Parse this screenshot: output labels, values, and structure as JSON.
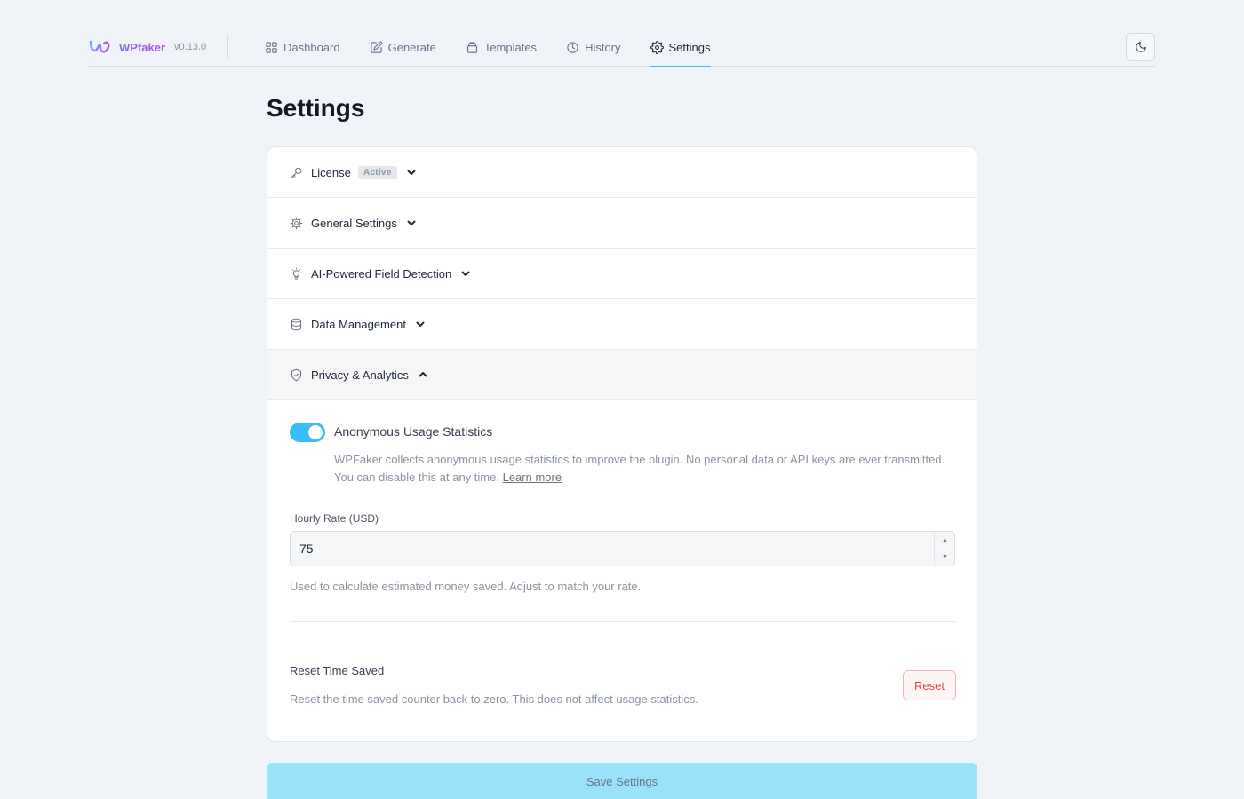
{
  "brand": {
    "name": "WPfaker",
    "version": "v0.13.0",
    "logo_icon": "wpfaker-logo-icon"
  },
  "nav": {
    "items": [
      {
        "label": "Dashboard",
        "icon": "grid-icon",
        "active": false
      },
      {
        "label": "Generate",
        "icon": "edit-icon",
        "active": false
      },
      {
        "label": "Templates",
        "icon": "template-icon",
        "active": false
      },
      {
        "label": "History",
        "icon": "clock-icon",
        "active": false
      },
      {
        "label": "Settings",
        "icon": "gear-icon",
        "active": true
      }
    ],
    "theme_toggle_icon": "moon-icon"
  },
  "page": {
    "title": "Settings"
  },
  "sections": [
    {
      "label": "License",
      "icon": "key-icon",
      "badge": "Active",
      "expanded": false
    },
    {
      "label": "General Settings",
      "icon": "gear-icon",
      "expanded": false
    },
    {
      "label": "AI-Powered Field Detection",
      "icon": "lightbulb-icon",
      "expanded": false
    },
    {
      "label": "Data Management",
      "icon": "database-icon",
      "expanded": false
    },
    {
      "label": "Privacy & Analytics",
      "icon": "shield-icon",
      "expanded": true
    }
  ],
  "privacy": {
    "usage_stats": {
      "enabled": true,
      "title": "Anonymous Usage Statistics",
      "description": "WPFaker collects anonymous usage statistics to improve the plugin. No personal data or API keys are ever transmitted. You can disable this at any time.",
      "link_text": "Learn more"
    },
    "hourly_rate": {
      "label": "Hourly Rate (USD)",
      "value": "75",
      "help": "Used to calculate estimated money saved. Adjust to match your rate."
    },
    "reset": {
      "title": "Reset Time Saved",
      "description": "Reset the time saved counter back to zero. This does not affect usage statistics.",
      "button_label": "Reset"
    }
  },
  "actions": {
    "save_label": "Save Settings"
  },
  "colors": {
    "accent": "#38bdf8",
    "danger": "#dc4b4b",
    "brand_gradient_start": "#7c6cf2",
    "brand_gradient_end": "#c04ce6"
  }
}
